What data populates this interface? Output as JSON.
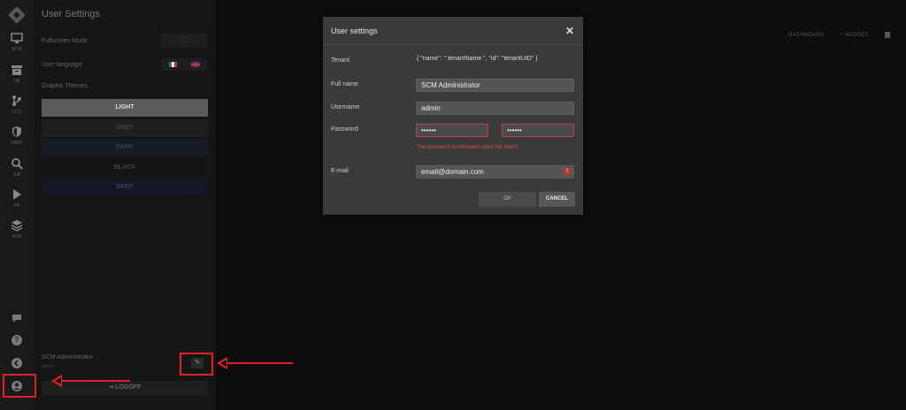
{
  "rail": {
    "items": [
      {
        "label": "SCM",
        "icon": "monitor-icon"
      },
      {
        "label": "LM",
        "icon": "archive-icon"
      },
      {
        "label": "LCS",
        "icon": "branch-icon"
      },
      {
        "label": "NMS",
        "icon": "shield-icon"
      },
      {
        "label": "SM",
        "icon": "search-icon"
      },
      {
        "label": "PB",
        "icon": "play-icon"
      },
      {
        "label": "ADE",
        "icon": "layers-icon"
      }
    ],
    "bottom": {
      "chat": "chat-icon",
      "help": "?",
      "back": "back-icon",
      "user": "user-icon"
    }
  },
  "panel": {
    "title": "User Settings",
    "fullscreen_label": "Fullscreen Mode",
    "fullscreen_icon": "⛶",
    "language_label": "User language",
    "themes_label": "Graphic Themes",
    "themes": [
      "LIGHT",
      "GREY",
      "DARK",
      "BLACK",
      "DEEP"
    ],
    "user_name": "SCM Administrator",
    "user_sub": "admin",
    "edit_icon": "✎",
    "logoff_label": "⇥ LOGOFF"
  },
  "dashboard": {
    "dashboard_link": "DASHBOARD",
    "widget_link": "+ WIDGET"
  },
  "modal": {
    "title": "User settings",
    "close": "✕",
    "tenant_label": "Tenant",
    "tenant_value": "{ \"name\": \" tenantName \", \"id\": \"tenantUID\" }",
    "fullname_label": "Full name",
    "fullname_value": "SCM Administrator",
    "username_label": "Username",
    "username_value": "admin",
    "password_label": "Password",
    "password_value": "••••••",
    "password_confirm_value": "••••••",
    "error_message": "The password confirmation does not match",
    "email_label": "E-mail",
    "email_value": "email@domain.com",
    "ok_label": "OK",
    "cancel_label": "CANCEL"
  },
  "colors": {
    "annotation_red": "#e3202a",
    "error_red": "#e24a4a",
    "modal_bg": "#3a3a3a"
  }
}
